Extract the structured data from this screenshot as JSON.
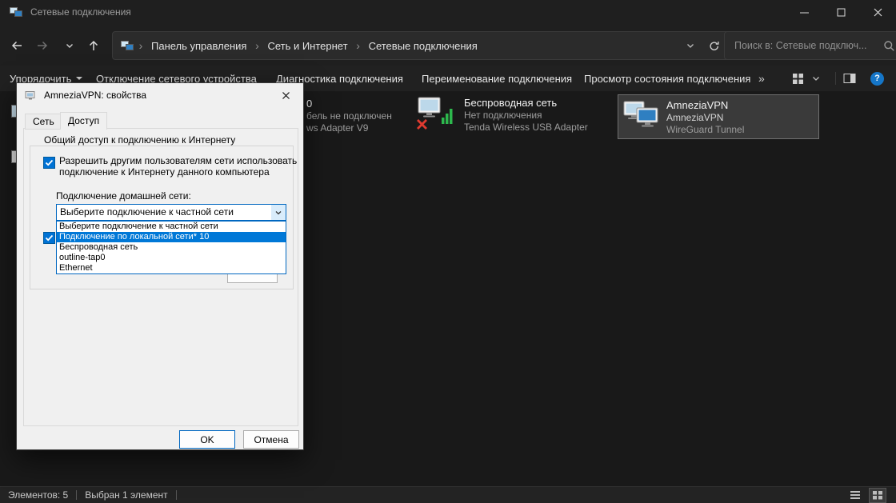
{
  "titlebar": {
    "title": "Сетевые подключения"
  },
  "navbar": {
    "breadcrumb": {
      "crumbs": [
        "Панель управления",
        "Сеть и Интернет",
        "Сетевые подключения"
      ]
    },
    "search": {
      "placeholder": "Поиск в: Сетевые подключ..."
    }
  },
  "toolbar": {
    "organize": "Упорядочить",
    "items": [
      "Отключение сетевого устройства",
      "Диагностика подключения",
      "Переименование подключения",
      "Просмотр состояния подключения"
    ]
  },
  "connections": {
    "partial": {
      "line1": "0",
      "line2": "бель не подключен",
      "line3": "ws Adapter V9"
    },
    "wireless": {
      "name": "Беспроводная сеть",
      "status": "Нет подключения",
      "device": "Tenda Wireless USB Adapter"
    },
    "vpn": {
      "name": "AmneziaVPN",
      "status": "AmneziaVPN",
      "device": "WireGuard Tunnel"
    }
  },
  "dialog": {
    "title": "AmneziaVPN: свойства",
    "tabs": {
      "network": "Сеть",
      "access": "Доступ"
    },
    "group_title": "Общий доступ к подключению к Интернету",
    "share_checkbox": "Разрешить другим пользователям сети использовать подключение к Интернету данного компьютера",
    "home_network_label": "Подключение домашней сети:",
    "combo": {
      "value": "Выберите подключение к частной сети"
    },
    "dropdown": {
      "items": [
        "Выберите подключение к частной сети",
        "Подключение по локальной сети* 10",
        "Беспроводная сеть",
        "outline-tap0",
        "Ethernet"
      ],
      "selected_index": 1
    },
    "buttons": {
      "ok": "OK",
      "cancel": "Отмена"
    }
  },
  "statusbar": {
    "count": "Элементов: 5",
    "selection": "Выбран 1 элемент"
  },
  "colors": {
    "accent": "#0078d7",
    "checkbox_blue": "#0072d4",
    "error_red": "#e03a2f",
    "signal_green": "#2db84d",
    "help_blue": "#1576c8",
    "selected_tile_bg": "#3a3a3a",
    "chrome_bg": "#1f1f1f",
    "content_bg": "#191919"
  },
  "icons": {
    "app": "network-monitors",
    "back": "arrow-left",
    "forward": "arrow-right",
    "recent": "chevron-down",
    "up": "arrow-up",
    "address_dropdown": "chevron-down",
    "refresh": "refresh-arrow",
    "search": "magnifier",
    "view": "grid",
    "preview_pane": "split-pane",
    "help": "question-circle",
    "minimize": "line",
    "maximize": "square",
    "close": "x",
    "disconnected": "red-x",
    "wifi": "signal-bars",
    "status_details": "list-view",
    "status_icons": "icon-view"
  }
}
